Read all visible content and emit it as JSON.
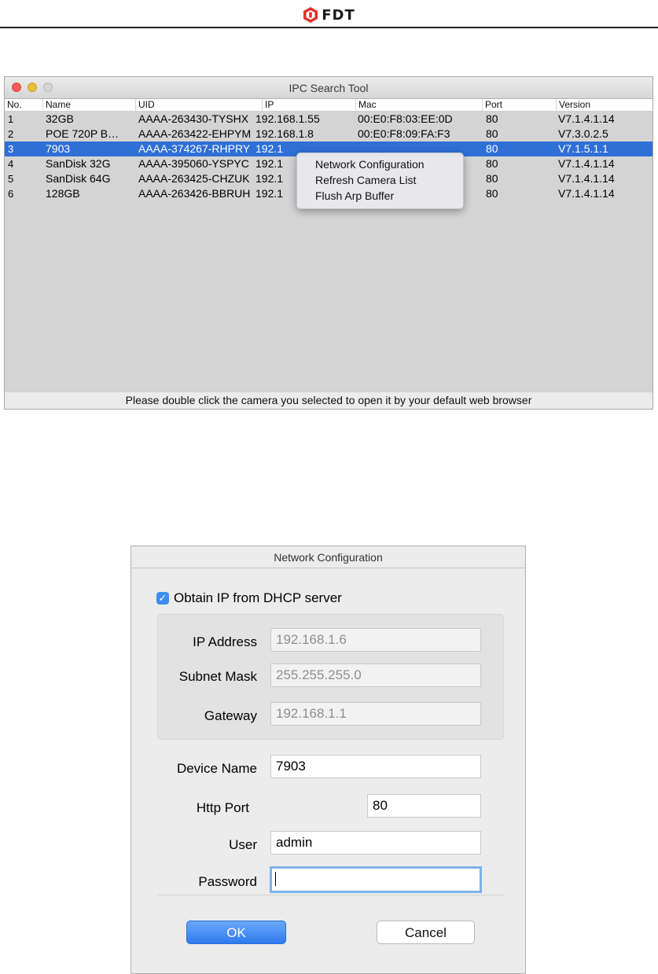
{
  "header": {
    "brand": "FDT"
  },
  "ipc_window": {
    "title": "IPC Search Tool",
    "columns": [
      "No.",
      "Name",
      "UID",
      "IP",
      "Mac",
      "Port",
      "Version"
    ],
    "rows": [
      {
        "no": "1",
        "name": "32GB",
        "uid": "AAAA-263430-TYSHX",
        "ip": "192.168.1.55",
        "mac": "00:E0:F8:03:EE:0D",
        "port": "80",
        "version": "V7.1.4.1.14"
      },
      {
        "no": "2",
        "name": "POE 720P B…",
        "uid": "AAAA-263422-EHPYM",
        "ip": "192.168.1.8",
        "mac": "00:E0:F8:09:FA:F3",
        "port": "80",
        "version": "V7.3.0.2.5"
      },
      {
        "no": "3",
        "name": "7903",
        "uid": "AAAA-374267-RHPRY",
        "ip": "192.1",
        "mac": "",
        "port": "80",
        "version": "V7.1.5.1.1"
      },
      {
        "no": "4",
        "name": "SanDisk 32G",
        "uid": "AAAA-395060-YSPYC",
        "ip": "192.1",
        "mac": "",
        "port": "80",
        "version": "V7.1.4.1.14"
      },
      {
        "no": "5",
        "name": "SanDisk 64G",
        "uid": "AAAA-263425-CHZUK",
        "ip": "192.1",
        "mac": "",
        "port": "80",
        "version": "V7.1.4.1.14"
      },
      {
        "no": "6",
        "name": "128GB",
        "uid": "AAAA-263426-BBRUH",
        "ip": "192.1",
        "mac": "",
        "port": "80",
        "version": "V7.1.4.1.14"
      }
    ],
    "selected_row": 3,
    "footer": "Please double click the camera you selected to open it by your default web browser",
    "context_menu": [
      "Network Configuration",
      "Refresh Camera List",
      "Flush Arp Buffer"
    ]
  },
  "network_dialog": {
    "title": "Network Configuration",
    "dhcp_label": "Obtain IP from DHCP server",
    "dhcp_checked": true,
    "ip_label": "IP Address",
    "ip_value": "192.168.1.6",
    "mask_label": "Subnet Mask",
    "mask_value": "255.255.255.0",
    "gateway_label": "Gateway",
    "gateway_value": "192.168.1.1",
    "device_name_label": "Device Name",
    "device_name_value": "7903",
    "http_port_label": "Http Port",
    "http_port_value": "80",
    "user_label": "User",
    "user_value": "admin",
    "password_label": "Password",
    "password_value": "",
    "ok_label": "OK",
    "cancel_label": "Cancel"
  },
  "colors": {
    "selection": "#2f6fd6",
    "accent": "#3b8ef0",
    "brand_red": "#e0312b"
  }
}
